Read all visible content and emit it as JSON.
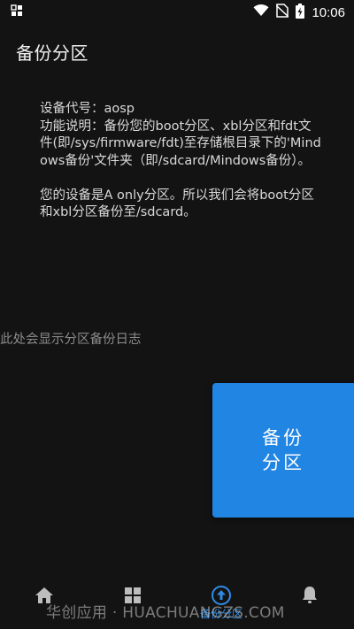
{
  "status_bar": {
    "time": "10:06",
    "left_icon": "notification-grid-icon",
    "icons": [
      "wifi-icon",
      "no-sim-icon",
      "battery-charging-icon"
    ]
  },
  "app_bar": {
    "title": "备份分区"
  },
  "description": {
    "text": "设备代号：aosp\n功能说明：备份您的boot分区、xbl分区和fdt文件(即/sys/firmware/fdt)至存储根目录下的'Mindows备份'文件夹（即/sdcard/Mindows备份）。\n\n您的设备是A only分区。所以我们会将boot分区和xbl分区备份至/sdcard。"
  },
  "log": {
    "placeholder": "此处会显示分区备份日志"
  },
  "actions": {
    "backup_button_label": "备份分区"
  },
  "bottom_nav": {
    "items": [
      {
        "icon": "home-icon",
        "label": ""
      },
      {
        "icon": "apps-grid-icon",
        "label": ""
      },
      {
        "icon": "upload-circle-icon",
        "label": "备份分区"
      },
      {
        "icon": "bell-icon",
        "label": ""
      }
    ]
  },
  "watermark": {
    "text": "华创应用 · HUACHUANGZS.COM"
  },
  "colors": {
    "background": "#131313",
    "accent": "#2185e3",
    "text_primary": "#f2f2f2",
    "text_secondary": "#8a8a8a"
  }
}
